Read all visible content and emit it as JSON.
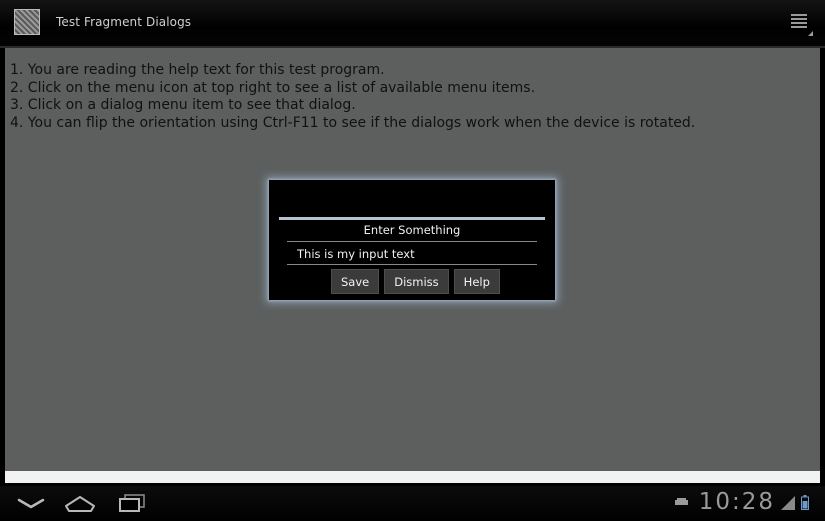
{
  "action_bar": {
    "title": "Test Fragment Dialogs",
    "app_icon": "app-launcher-icon",
    "menu_icon": "overflow-menu-icon"
  },
  "help": {
    "lines": [
      "1. You are reading the help text for this test program.",
      "2. Click on the menu icon at top right to see a list of available menu items.",
      "3. Click on a dialog menu item to see that dialog.",
      "4. You can flip the orientation using Ctrl-F11 to see if the dialogs work when the device is rotated."
    ]
  },
  "dialog": {
    "title": "Enter Something",
    "input_value": "This is my input text",
    "buttons": {
      "save": "Save",
      "dismiss": "Dismiss",
      "help": "Help"
    }
  },
  "system_bar": {
    "clock": "10:28",
    "icons": [
      "back-icon",
      "home-icon",
      "recent-apps-icon",
      "usb-icon",
      "signal-icon",
      "battery-icon"
    ]
  },
  "colors": {
    "content_bg": "#5c5f5e",
    "dialog_bg": "#000000",
    "dialog_glow": "#8a9aae",
    "bar_bg": "#000000"
  }
}
